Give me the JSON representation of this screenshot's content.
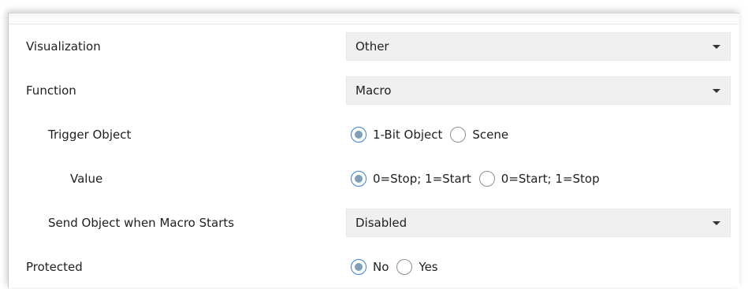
{
  "rows": {
    "visualization": {
      "label": "Visualization",
      "value": "Other"
    },
    "function": {
      "label": "Function",
      "value": "Macro"
    },
    "trigger_object": {
      "label": "Trigger Object",
      "options": [
        "1-Bit Object",
        "Scene"
      ],
      "selected": "1-Bit Object"
    },
    "value": {
      "label": "Value",
      "options": [
        "0=Stop; 1=Start",
        "0=Start; 1=Stop"
      ],
      "selected": "0=Stop; 1=Start"
    },
    "send_object": {
      "label": "Send Object when Macro Starts",
      "value": "Disabled"
    },
    "protected": {
      "label": "Protected",
      "options": [
        "No",
        "Yes"
      ],
      "selected": "No"
    }
  },
  "colors": {
    "dropdown_bg": "#f0f0f0",
    "radio_selected_dot": "#7f9fb8",
    "radio_selected_ring": "#3c7fd1"
  }
}
